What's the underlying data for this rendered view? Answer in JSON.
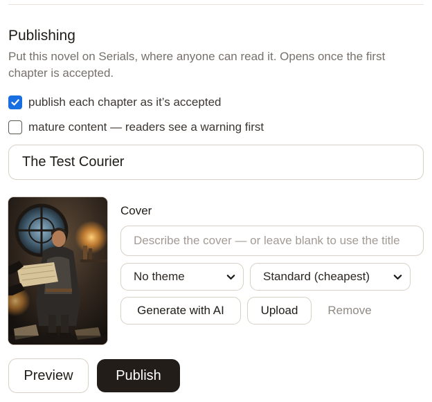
{
  "section": {
    "heading": "Publishing",
    "description": "Put this novel on Serials, where anyone can read it. Opens once the first chapter is accepted."
  },
  "options": {
    "publish_each": {
      "label": "publish each chapter as it’s accepted",
      "checked": true
    },
    "mature": {
      "label": "mature content — readers see a warning first",
      "checked": false
    }
  },
  "title_input": {
    "value": "The Test Courier"
  },
  "cover": {
    "label": "Cover",
    "prompt_placeholder": "Describe the cover — or leave blank to use the title",
    "theme_select": {
      "selected": "No theme"
    },
    "quality_select": {
      "selected": "Standard (cheapest)"
    },
    "generate_label": "Generate with AI",
    "upload_label": "Upload",
    "remove_label": "Remove"
  },
  "actions": {
    "preview_label": "Preview",
    "publish_label": "Publish"
  },
  "colors": {
    "accent": "#1a6fe0",
    "primary_button": "#221d19",
    "border": "#d7d0c5",
    "muted_text": "#76706a"
  },
  "icons": {
    "checkbox_checked": "checkmark-icon",
    "select_arrow": "chevron-down-icon"
  }
}
